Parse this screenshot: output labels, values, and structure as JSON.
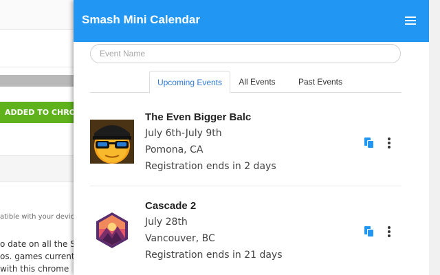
{
  "background": {
    "install_button": "ADDED TO CHROME",
    "text_lines": [
      "atible with your devic",
      "o date on all the Sm",
      "os. games currently",
      "with this chrome"
    ]
  },
  "app": {
    "title": "Smash Mini Calendar",
    "header_color": "#2196f3",
    "menu_icon": "hamburger-menu-icon"
  },
  "search": {
    "placeholder": "Event Name",
    "value": ""
  },
  "tabs": [
    {
      "label": "Upcoming Events",
      "active": true
    },
    {
      "label": "All Events",
      "active": false
    },
    {
      "label": "Past Events",
      "active": false
    }
  ],
  "events": [
    {
      "name": "The Even Bigger Balc",
      "dates": "July 6th-July 9th",
      "location": "Pomona, CA",
      "registration": "Registration ends in 2 days",
      "thumb": "sunglasses-cap-face-logo"
    },
    {
      "name": "Cascade 2",
      "dates": "July 28th",
      "location": "Vancouver, BC",
      "registration": "Registration ends in 21 days",
      "thumb": "hexagon-mountain-logo"
    }
  ],
  "icons": {
    "copy": "copy-icon",
    "more": "more-vert-icon"
  },
  "accent_color": "#2196f3"
}
